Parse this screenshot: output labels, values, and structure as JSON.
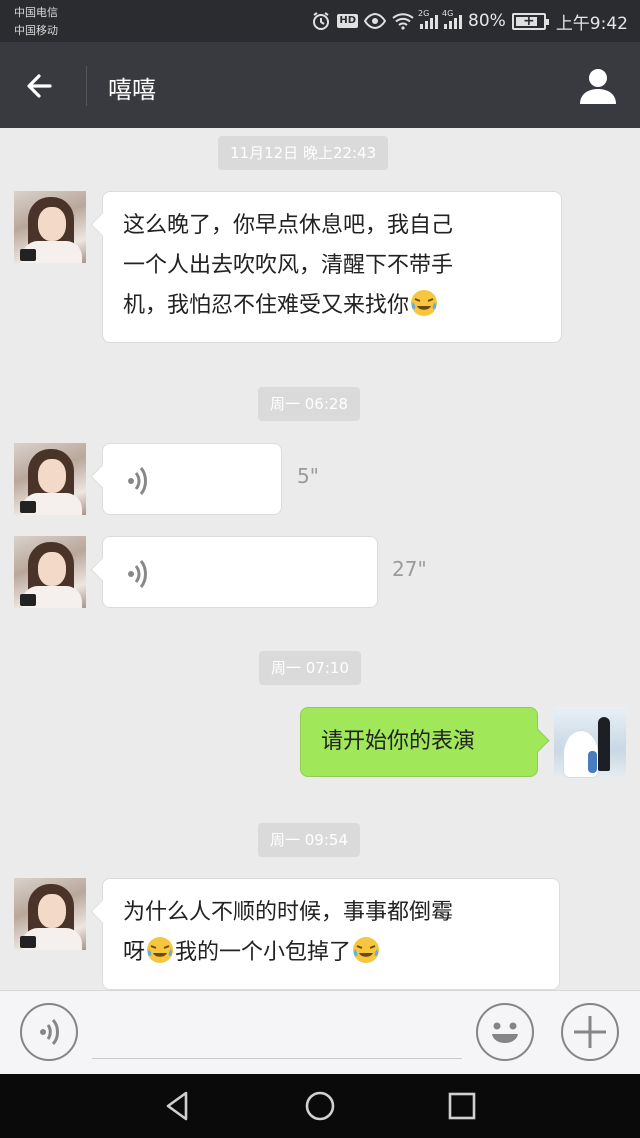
{
  "status_bar": {
    "carrier_1": "中国电信",
    "carrier_2": "中国移动",
    "signal_1_tag": "2G",
    "signal_2_tag": "4G",
    "hd_label": "HD",
    "battery_percent": "80%",
    "battery_level": 0.8,
    "time": "上午9:42",
    "icons": [
      "alarm-icon",
      "hd-icon",
      "eye-icon",
      "wifi-icon",
      "signal-icon",
      "battery-icon"
    ]
  },
  "header": {
    "title": "嘻嘻",
    "back_icon": "back-arrow-icon",
    "profile_icon": "person-icon"
  },
  "messages": [
    {
      "type": "time",
      "text": "11月12日  晚上22:43"
    },
    {
      "type": "text",
      "side": "left",
      "lines": [
        "这么晚了，你早点休息吧，我自己",
        "一个人出去吹吹风，清醒下不带手",
        "机，我怕忍不住难受又来找你"
      ],
      "trailing_emoji": "crying-laughing-emoji"
    },
    {
      "type": "time",
      "text": "周一  06:28"
    },
    {
      "type": "voice",
      "side": "left",
      "duration": "5\""
    },
    {
      "type": "voice",
      "side": "left",
      "duration": "27\""
    },
    {
      "type": "time",
      "text": "周一  07:10"
    },
    {
      "type": "text",
      "side": "right",
      "text": "请开始你的表演"
    },
    {
      "type": "time",
      "text": "周一  09:54"
    },
    {
      "type": "text",
      "side": "left",
      "line_1": "为什么人不顺的时候，事事都倒霉",
      "line_2_a": "呀",
      "line_2_b": "我的一个小包掉了",
      "emoji": "crying-laughing-emoji"
    }
  ],
  "input_bar": {
    "voice_icon": "voice-icon",
    "emoji_icon": "smiley-icon",
    "plus_icon": "plus-icon",
    "input_value": ""
  },
  "nav_bar": {
    "icons": [
      "back-triangle-icon",
      "home-circle-icon",
      "recents-square-icon"
    ]
  },
  "colors": {
    "status_bar_bg": "#2b2c30",
    "header_bg": "#393a3f",
    "chat_bg": "#ebebeb",
    "sent_bubble": "#a0e75a",
    "received_bubble": "#ffffff",
    "timestamp_bg": "#dadada"
  }
}
